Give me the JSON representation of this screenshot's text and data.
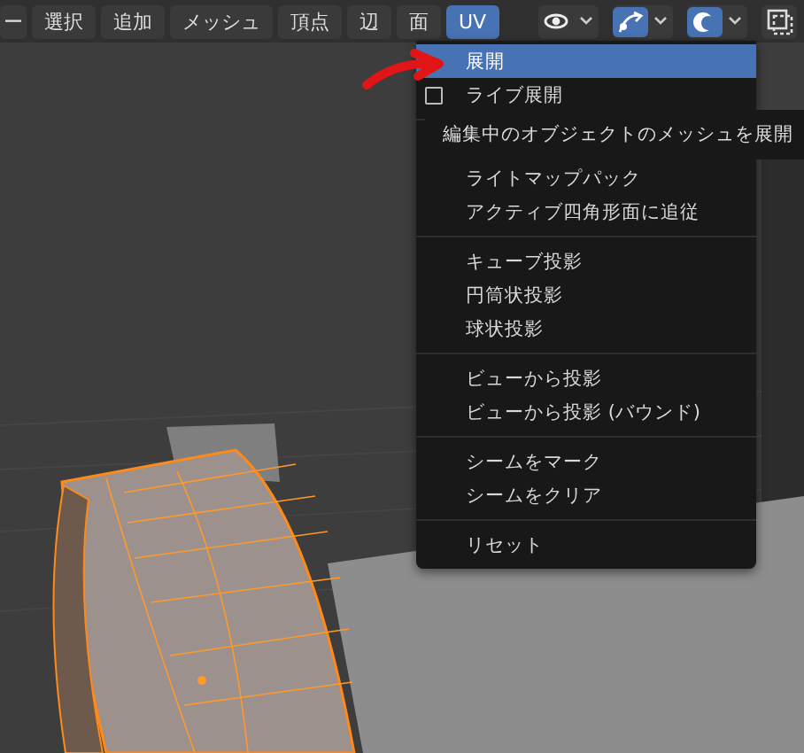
{
  "header": {
    "menus": [
      {
        "label": "ー",
        "selected": false
      },
      {
        "label": "選択",
        "selected": false
      },
      {
        "label": "追加",
        "selected": false
      },
      {
        "label": "メッシュ",
        "selected": false
      },
      {
        "label": "頂点",
        "selected": false
      },
      {
        "label": "辺",
        "selected": false
      },
      {
        "label": "面",
        "selected": false
      },
      {
        "label": "UV",
        "selected": true
      }
    ],
    "tools": [
      {
        "kind": "visibility",
        "on": false,
        "caret": true
      },
      {
        "kind": "gizmo",
        "on": true,
        "caret": true
      },
      {
        "kind": "overlay",
        "on": true,
        "caret": true
      },
      {
        "kind": "xray",
        "on": false,
        "caret": false
      }
    ]
  },
  "uv_menu": {
    "items": [
      {
        "kind": "action",
        "label": "展開",
        "selected": true
      },
      {
        "kind": "checkbox",
        "label": "ライブ展開",
        "checked": false,
        "selected": false
      },
      {
        "kind": "separator"
      },
      {
        "kind": "hidden"
      },
      {
        "kind": "action",
        "label": "ライトマップパック",
        "selected": false
      },
      {
        "kind": "action",
        "label": "アクティブ四角形面に追従",
        "selected": false
      },
      {
        "kind": "separator"
      },
      {
        "kind": "action",
        "label": "キューブ投影",
        "selected": false
      },
      {
        "kind": "action",
        "label": "円筒状投影",
        "selected": false
      },
      {
        "kind": "action",
        "label": "球状投影",
        "selected": false
      },
      {
        "kind": "separator"
      },
      {
        "kind": "action",
        "label": "ビューから投影",
        "selected": false
      },
      {
        "kind": "action",
        "label": "ビューから投影 (バウンド)",
        "selected": false
      },
      {
        "kind": "separator"
      },
      {
        "kind": "action",
        "label": "シームをマーク",
        "selected": false
      },
      {
        "kind": "action",
        "label": "シームをクリア",
        "selected": false
      },
      {
        "kind": "separator"
      },
      {
        "kind": "action",
        "label": "リセット",
        "selected": false
      }
    ]
  },
  "tooltip": {
    "text": "編集中のオブジェクトのメッシュを展開"
  }
}
